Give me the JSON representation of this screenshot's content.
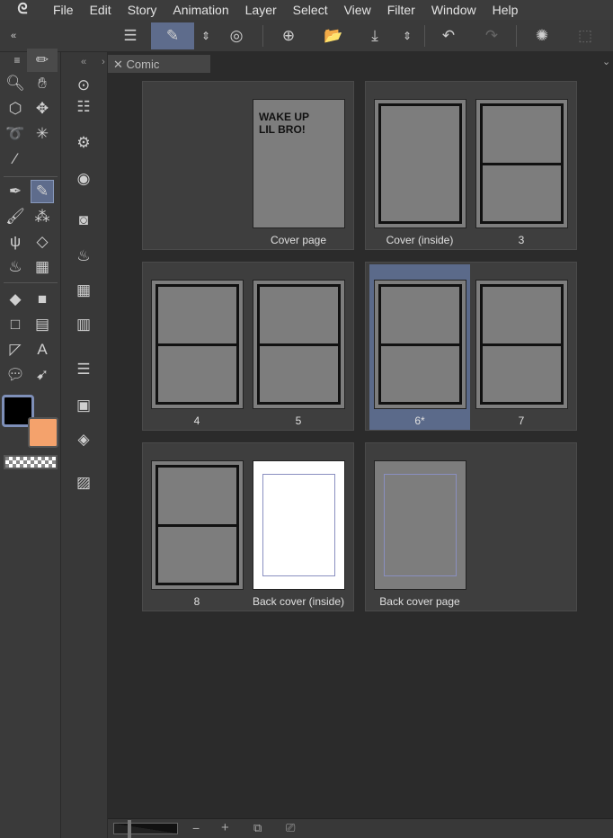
{
  "menu": [
    "File",
    "Edit",
    "Story",
    "Animation",
    "Layer",
    "Select",
    "View",
    "Filter",
    "Window",
    "Help"
  ],
  "tab": {
    "label": "Comic"
  },
  "spreads": [
    {
      "pages": [
        {
          "label": "Cover page",
          "type": "cover",
          "art_text": "WAKE UP LIL BRO!",
          "pos": "right"
        }
      ]
    },
    {
      "pages": [
        {
          "label": "Cover (inside)",
          "type": "full"
        },
        {
          "label": "3",
          "type": "split"
        }
      ]
    },
    {
      "pages": [
        {
          "label": "4",
          "type": "split"
        },
        {
          "label": "5",
          "type": "split"
        }
      ]
    },
    {
      "pages": [
        {
          "label": "6*",
          "type": "split",
          "selected": true
        },
        {
          "label": "7",
          "type": "split"
        }
      ]
    },
    {
      "pages": [
        {
          "label": "8",
          "type": "split"
        },
        {
          "label": "Back cover (inside)",
          "type": "blank"
        }
      ]
    },
    {
      "pages": [
        {
          "label": "Back cover page",
          "type": "blank-gray"
        }
      ]
    }
  ],
  "colors": {
    "main": "#000000",
    "sub": "#f4a26c",
    "accent": "#5e6c8c"
  },
  "bottombar": {
    "minus": "−",
    "plus": "+"
  }
}
